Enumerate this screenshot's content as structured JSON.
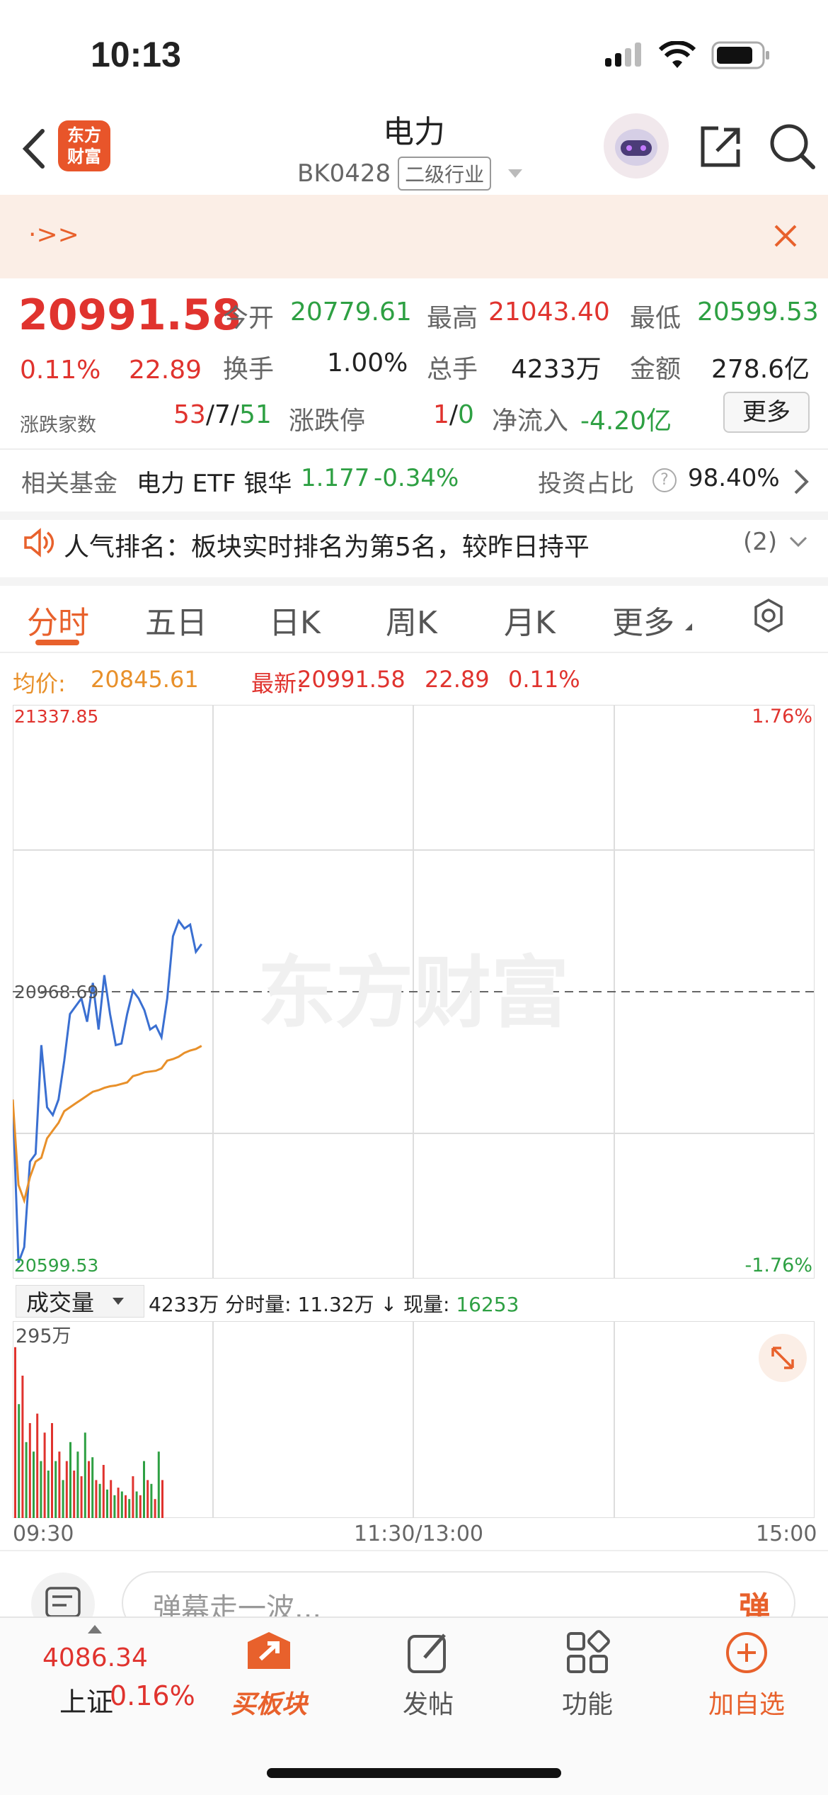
{
  "status": {
    "time": "10:13"
  },
  "header": {
    "title": "电力",
    "code": "BK0428",
    "tag": "二级行业",
    "logo_text": "东方\n财富"
  },
  "notice": {
    "text": "·>>"
  },
  "quote": {
    "price": "20991.58",
    "change_pct": "0.11%",
    "change": "22.89",
    "open_label": "今开",
    "open": "20779.61",
    "high_label": "最高",
    "high": "21043.40",
    "low_label": "最低",
    "low": "20599.53",
    "turnover_label": "换手",
    "turnover": "1.00%",
    "volume_label": "总手",
    "volume": "4233万",
    "amount_label": "金额",
    "amount": "278.6亿",
    "updown_label": "涨跌家数",
    "up": "53",
    "flat": "7",
    "down": "51",
    "limit_label": "涨跌停",
    "limit_up": "1",
    "limit_down": "0",
    "netflow_label": "净流入",
    "netflow": "-4.20亿",
    "more_label": "更多"
  },
  "fund": {
    "label": "相关基金",
    "name": "电力 ETF 银华",
    "price": "1.177",
    "pct": "-0.34%",
    "invest_label": "投资占比",
    "invest_value": "98.40%"
  },
  "ranking": {
    "text": "人气排名：板块实时排名为第5名，较昨日持平",
    "count": "(2)"
  },
  "tabs": [
    {
      "label": "分时"
    },
    {
      "label": "五日"
    },
    {
      "label": "日K"
    },
    {
      "label": "周K"
    },
    {
      "label": "月K"
    },
    {
      "label": "更多"
    }
  ],
  "legend": {
    "avg_label": "均价:",
    "avg": "20845.61",
    "latest_label": "最新:",
    "latest": "20991.58",
    "latest_change": "22.89",
    "latest_pct": "0.11%"
  },
  "chart_data": {
    "type": "line",
    "y_top_label": "21337.85",
    "y_mid_label": "20968.69",
    "y_bottom_label": "20599.53",
    "pct_top": "1.76%",
    "pct_bottom": "-1.76%",
    "ylim": [
      20599.53,
      21337.85
    ],
    "watermark": "东方财富",
    "x_labels": [
      "09:30",
      "11:30/13:00",
      "15:00"
    ],
    "series": [
      {
        "color": "#3a6fd1",
        "values": [
          20830,
          20620,
          20640,
          20750,
          20760,
          20900,
          20820,
          20810,
          20830,
          20880,
          20940,
          20950,
          20960,
          20930,
          20980,
          20920,
          20990,
          20940,
          20900,
          20902,
          20940,
          20970,
          20960,
          20945,
          20920,
          20925,
          20910,
          20960,
          21040,
          21060,
          21050,
          21055,
          21020,
          21030
        ]
      },
      {
        "color": "#e8902a",
        "values": [
          20830,
          20720,
          20700,
          20730,
          20750,
          20755,
          20780,
          20790,
          20800,
          20815,
          20820,
          20825,
          20830,
          20835,
          20840,
          20842,
          20845,
          20847,
          20848,
          20850,
          20852,
          20860,
          20862,
          20865,
          20866,
          20867,
          20870,
          20880,
          20882,
          20885,
          20890,
          20893,
          20895,
          20899
        ]
      }
    ],
    "volume": {
      "label": "成交量",
      "total": "4233万",
      "minute_label": "分时量:",
      "minute": "11.32万",
      "now_label": "现量:",
      "now": "16253",
      "max_label": "295万",
      "bars": [
        90,
        60,
        75,
        40,
        50,
        35,
        55,
        30,
        45,
        25,
        50,
        30,
        35,
        20,
        30,
        40,
        25,
        35,
        22,
        45,
        30,
        32,
        20,
        18,
        28,
        15,
        20,
        12,
        16,
        14,
        12,
        10,
        22,
        14,
        12,
        30,
        20,
        18,
        10,
        35,
        20
      ]
    }
  },
  "danmaku": {
    "placeholder": "弹幕走一波...",
    "btn": "弹"
  },
  "bottom_nav": {
    "index_value": "4086.34",
    "index_name": "上证",
    "index_pct": "0.16%",
    "items": [
      {
        "label": "买板块"
      },
      {
        "label": "发帖"
      },
      {
        "label": "功能"
      },
      {
        "label": "加自选"
      }
    ]
  }
}
